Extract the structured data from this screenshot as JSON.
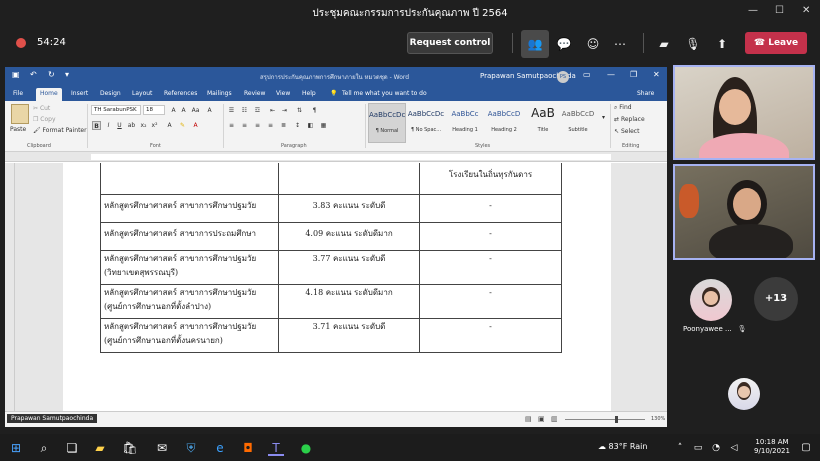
{
  "meeting": {
    "title": "ประชุมคณะกรรมการประกันคุณภาพ ปี 2564",
    "timer": "54:24",
    "request_control": "Request control",
    "leave": "Leave"
  },
  "word": {
    "doc_title": "สรุปการประกันคุณภาพการศึกษาภายใน หมวดชุด - Word",
    "user": "Prapawan Samutpaochinda",
    "user_initials": "PS",
    "tabs": [
      "File",
      "Home",
      "Insert",
      "Design",
      "Layout",
      "References",
      "Mailings",
      "Review",
      "View",
      "Help"
    ],
    "tell_me": "Tell me what you want to do",
    "share": "Share",
    "font_name": "TH SarabunPSK",
    "font_size": "18",
    "clipboard": {
      "paste": "Paste",
      "cut": "Cut",
      "copy": "Copy",
      "format_painter": "Format Painter"
    },
    "groups": {
      "clipboard": "Clipboard",
      "font": "Font",
      "paragraph": "Paragraph",
      "styles": "Styles",
      "editing": "Editing"
    },
    "styles": [
      {
        "sample": "AaBbCcDc",
        "label": "¶ Normal"
      },
      {
        "sample": "AaBbCcDc",
        "label": "¶ No Spac..."
      },
      {
        "sample": "AaBbCc",
        "label": "Heading 1"
      },
      {
        "sample": "AaBbCcD",
        "label": "Heading 2"
      },
      {
        "sample": "AaB",
        "label": "Title"
      },
      {
        "sample": "AaBbCcD",
        "label": "Subtitle"
      }
    ],
    "editing": {
      "find": "Find",
      "replace": "Replace",
      "select": "Select"
    },
    "table_rows": [
      {
        "program": "",
        "score": "",
        "note": "โรงเรียนในถิ่นทุรกันดาร"
      },
      {
        "program": "หลักสูตรศึกษาศาสตร์ สาขาการศึกษาปฐมวัย",
        "score": "3.83 คะแนน ระดับดี",
        "note": "-"
      },
      {
        "program": "หลักสูตรศึกษาศาสตร์ สาขาการประถมศึกษา",
        "score": "4.09 คะแนน ระดับดีมาก",
        "note": "-"
      },
      {
        "program": "หลักสูตรศึกษาศาสตร์ สาขาการศึกษาปฐมวัย (วิทยาเขตสุพรรณบุรี)",
        "score": "3.77 คะแนน ระดับดี",
        "note": "-"
      },
      {
        "program": "หลักสูตรศึกษาศาสตร์ สาขาการศึกษาปฐมวัย (ศูนย์การศึกษานอกที่ตั้งลำปาง)",
        "score": "4.18 คะแนน ระดับดีมาก",
        "note": "-"
      },
      {
        "program": "หลักสูตรศึกษาศาสตร์ สาขาการศึกษาปฐมวัย (ศูนย์การศึกษานอกที่ตั้งนครนายก)",
        "score": "3.71 คะแนน ระดับดี",
        "note": "-"
      }
    ],
    "zoom": "130%",
    "presenter_tag": "Prapawan Samutpaochinda"
  },
  "participants": {
    "more_count": "+13",
    "name": "Poonyawee ..."
  },
  "taskbar": {
    "temperature": "83°F",
    "weather": "Rain",
    "time": "10:18 AM",
    "date": "9/10/2021"
  }
}
